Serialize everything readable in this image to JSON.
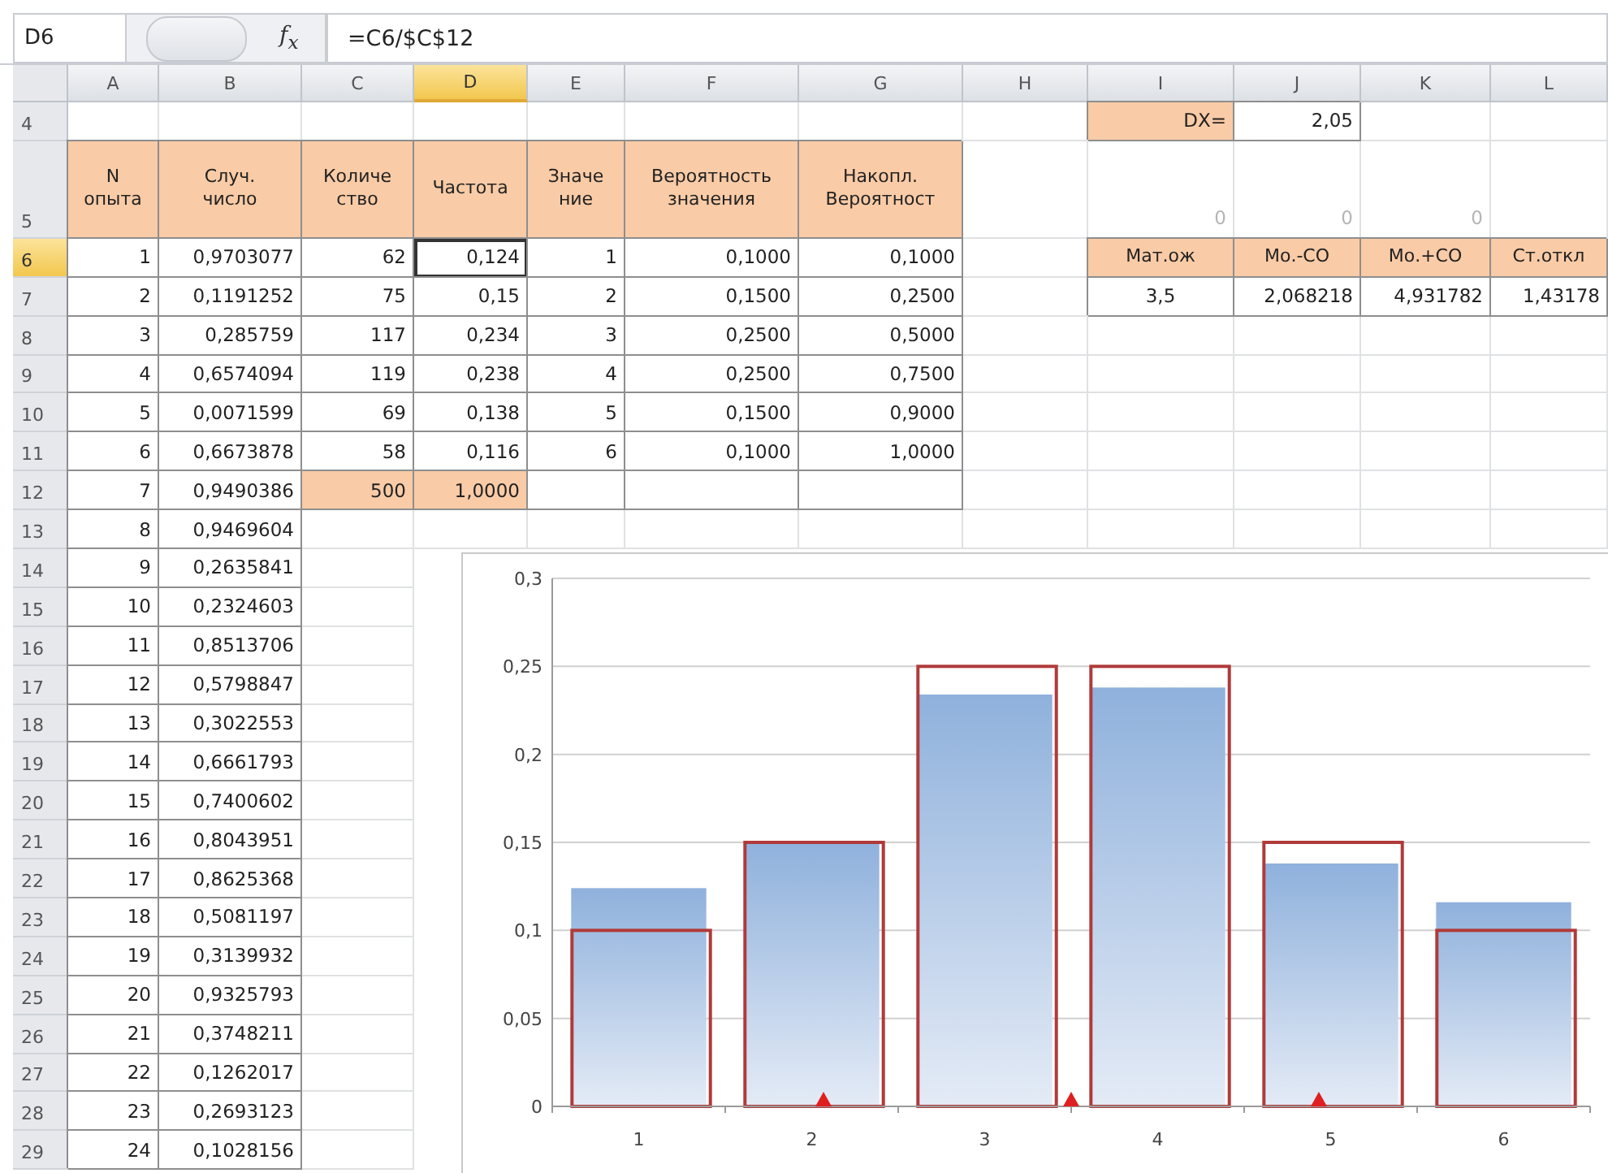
{
  "formula_bar": {
    "name_box": "D6",
    "function_button": "f$_{x}$",
    "formula": "=C6/$C$12"
  },
  "columns": [
    {
      "label": "A",
      "selected": false
    },
    {
      "label": "B",
      "selected": false
    },
    {
      "label": "C",
      "selected": false
    },
    {
      "label": "D",
      "selected": true
    },
    {
      "label": "E",
      "selected": false
    },
    {
      "label": "F",
      "selected": false
    },
    {
      "label": "G",
      "selected": false
    },
    {
      "label": "H",
      "selected": false
    },
    {
      "label": "I",
      "selected": false
    },
    {
      "label": "J",
      "selected": false
    },
    {
      "label": "K",
      "selected": false
    },
    {
      "label": "L",
      "selected": false
    }
  ],
  "rows": [
    {
      "number": "4",
      "selected": false,
      "cells": [
        {
          "kind": "empty"
        },
        {
          "kind": "empty"
        },
        {
          "kind": "empty"
        },
        {
          "kind": "empty"
        },
        {
          "kind": "empty"
        },
        {
          "kind": "empty"
        },
        {
          "kind": "empty"
        },
        {
          "kind": "empty"
        },
        {
          "kind": "total",
          "text": "DX=",
          "selected": false
        },
        {
          "kind": "value",
          "text": "2,05",
          "selected": false
        }
      ]
    },
    {
      "number": "5",
      "selected": false,
      "kind": "header",
      "cells": [
        {
          "kind": "heading",
          "text": "N\nопыта",
          "selected": false
        },
        {
          "kind": "heading",
          "text": "Случ.\nчисло",
          "selected": false
        },
        {
          "kind": "heading",
          "text": "Количе\nство",
          "selected": false
        },
        {
          "kind": "heading",
          "text": "Частота",
          "selected": false
        },
        {
          "kind": "heading",
          "text": "Значе\nние",
          "selected": false
        },
        {
          "kind": "heading",
          "text": "Вероятность\nзначения",
          "selected": false
        },
        {
          "kind": "heading",
          "text": "Накопл.\nВероятност",
          "selected": false
        },
        {
          "kind": "empty"
        },
        {
          "kind": "muted",
          "text": "0",
          "selected": false
        },
        {
          "kind": "muted",
          "text": "0",
          "selected": false
        },
        {
          "kind": "muted",
          "text": "0",
          "selected": false
        }
      ]
    },
    {
      "number": "6",
      "selected": true,
      "cells": [
        {
          "kind": "value",
          "text": "1",
          "selected": false
        },
        {
          "kind": "value",
          "text": "0,9703077",
          "selected": false
        },
        {
          "kind": "value",
          "text": "62",
          "selected": false
        },
        {
          "kind": "value",
          "text": "0,124",
          "selected": true
        },
        {
          "kind": "value",
          "text": "1",
          "selected": false
        },
        {
          "kind": "value",
          "text": "0,1000",
          "selected": false
        },
        {
          "kind": "value",
          "text": "0,1000",
          "selected": false
        },
        {
          "kind": "empty"
        },
        {
          "kind": "heading",
          "text": "Мат.ож",
          "selected": false
        },
        {
          "kind": "heading",
          "text": "Мо.-СО",
          "selected": false
        },
        {
          "kind": "heading",
          "text": "Мо.+СО",
          "selected": false
        },
        {
          "kind": "heading",
          "text": "Ст.откл",
          "selected": false
        }
      ]
    },
    {
      "number": "7",
      "selected": false,
      "cells": [
        {
          "kind": "value",
          "text": "2",
          "selected": false
        },
        {
          "kind": "value",
          "text": "0,1191252",
          "selected": false
        },
        {
          "kind": "value",
          "text": "75",
          "selected": false
        },
        {
          "kind": "value",
          "text": "0,15",
          "selected": false
        },
        {
          "kind": "value",
          "text": "2",
          "selected": false
        },
        {
          "kind": "value",
          "text": "0,1500",
          "selected": false
        },
        {
          "kind": "value",
          "text": "0,2500",
          "selected": false
        },
        {
          "kind": "empty"
        },
        {
          "kind": "centered",
          "text": "3,5",
          "selected": false
        },
        {
          "kind": "value",
          "text": "2,068218",
          "selected": false
        },
        {
          "kind": "value",
          "text": "4,931782",
          "selected": false
        },
        {
          "kind": "value",
          "text": "1,43178",
          "selected": false
        }
      ]
    },
    {
      "number": "8",
      "selected": false,
      "cells": [
        {
          "kind": "value",
          "text": "3",
          "selected": false
        },
        {
          "kind": "value",
          "text": "0,285759",
          "selected": false
        },
        {
          "kind": "value",
          "text": "117",
          "selected": false
        },
        {
          "kind": "value",
          "text": "0,234",
          "selected": false
        },
        {
          "kind": "value",
          "text": "3",
          "selected": false
        },
        {
          "kind": "value",
          "text": "0,2500",
          "selected": false
        },
        {
          "kind": "value",
          "text": "0,5000",
          "selected": false
        }
      ]
    },
    {
      "number": "9",
      "selected": false,
      "cells": [
        {
          "kind": "value",
          "text": "4",
          "selected": false
        },
        {
          "kind": "value",
          "text": "0,6574094",
          "selected": false
        },
        {
          "kind": "value",
          "text": "119",
          "selected": false
        },
        {
          "kind": "value",
          "text": "0,238",
          "selected": false
        },
        {
          "kind": "value",
          "text": "4",
          "selected": false
        },
        {
          "kind": "value",
          "text": "0,2500",
          "selected": false
        },
        {
          "kind": "value",
          "text": "0,7500",
          "selected": false
        }
      ]
    },
    {
      "number": "10",
      "selected": false,
      "cells": [
        {
          "kind": "value",
          "text": "5",
          "selected": false
        },
        {
          "kind": "value",
          "text": "0,0071599",
          "selected": false
        },
        {
          "kind": "value",
          "text": "69",
          "selected": false
        },
        {
          "kind": "value",
          "text": "0,138",
          "selected": false
        },
        {
          "kind": "value",
          "text": "5",
          "selected": false
        },
        {
          "kind": "value",
          "text": "0,1500",
          "selected": false
        },
        {
          "kind": "value",
          "text": "0,9000",
          "selected": false
        }
      ]
    },
    {
      "number": "11",
      "selected": false,
      "cells": [
        {
          "kind": "value",
          "text": "6",
          "selected": false
        },
        {
          "kind": "value",
          "text": "0,6673878",
          "selected": false
        },
        {
          "kind": "value",
          "text": "58",
          "selected": false
        },
        {
          "kind": "value",
          "text": "0,116",
          "selected": false
        },
        {
          "kind": "value",
          "text": "6",
          "selected": false
        },
        {
          "kind": "value",
          "text": "0,1000",
          "selected": false
        },
        {
          "kind": "value",
          "text": "1,0000",
          "selected": false
        }
      ]
    },
    {
      "number": "12",
      "selected": false,
      "cells": [
        {
          "kind": "value",
          "text": "7",
          "selected": false
        },
        {
          "kind": "value",
          "text": "0,9490386",
          "selected": false
        },
        {
          "kind": "total",
          "text": "500",
          "selected": false
        },
        {
          "kind": "total",
          "text": "1,0000",
          "selected": false
        },
        {
          "kind": "blank"
        },
        {
          "kind": "blank"
        },
        {
          "kind": "blank"
        }
      ]
    },
    {
      "number": "13",
      "selected": false,
      "cells": [
        {
          "kind": "value",
          "text": "8",
          "selected": false
        },
        {
          "kind": "value",
          "text": "0,9469604",
          "selected": false
        }
      ]
    },
    {
      "number": "14",
      "selected": false,
      "cells": [
        {
          "kind": "value",
          "text": "9",
          "selected": false
        },
        {
          "kind": "value",
          "text": "0,2635841",
          "selected": false
        }
      ]
    },
    {
      "number": "15",
      "selected": false,
      "cells": [
        {
          "kind": "value",
          "text": "10",
          "selected": false
        },
        {
          "kind": "value",
          "text": "0,2324603",
          "selected": false
        }
      ]
    },
    {
      "number": "16",
      "selected": false,
      "cells": [
        {
          "kind": "value",
          "text": "11",
          "selected": false
        },
        {
          "kind": "value",
          "text": "0,8513706",
          "selected": false
        }
      ]
    },
    {
      "number": "17",
      "selected": false,
      "cells": [
        {
          "kind": "value",
          "text": "12",
          "selected": false
        },
        {
          "kind": "value",
          "text": "0,5798847",
          "selected": false
        }
      ]
    },
    {
      "number": "18",
      "selected": false,
      "cells": [
        {
          "kind": "value",
          "text": "13",
          "selected": false
        },
        {
          "kind": "value",
          "text": "0,3022553",
          "selected": false
        }
      ]
    },
    {
      "number": "19",
      "selected": false,
      "cells": [
        {
          "kind": "value",
          "text": "14",
          "selected": false
        },
        {
          "kind": "value",
          "text": "0,6661793",
          "selected": false
        }
      ]
    },
    {
      "number": "20",
      "selected": false,
      "cells": [
        {
          "kind": "value",
          "text": "15",
          "selected": false
        },
        {
          "kind": "value",
          "text": "0,7400602",
          "selected": false
        }
      ]
    },
    {
      "number": "21",
      "selected": false,
      "cells": [
        {
          "kind": "value",
          "text": "16",
          "selected": false
        },
        {
          "kind": "value",
          "text": "0,8043951",
          "selected": false
        }
      ]
    },
    {
      "number": "22",
      "selected": false,
      "cells": [
        {
          "kind": "value",
          "text": "17",
          "selected": false
        },
        {
          "kind": "value",
          "text": "0,8625368",
          "selected": false
        }
      ]
    },
    {
      "number": "23",
      "selected": false,
      "cells": [
        {
          "kind": "value",
          "text": "18",
          "selected": false
        },
        {
          "kind": "value",
          "text": "0,5081197",
          "selected": false
        }
      ]
    },
    {
      "number": "24",
      "selected": false,
      "cells": [
        {
          "kind": "value",
          "text": "19",
          "selected": false
        },
        {
          "kind": "value",
          "text": "0,3139932",
          "selected": false
        }
      ]
    },
    {
      "number": "25",
      "selected": false,
      "cells": [
        {
          "kind": "value",
          "text": "20",
          "selected": false
        },
        {
          "kind": "value",
          "text": "0,9325793",
          "selected": false
        }
      ]
    },
    {
      "number": "26",
      "selected": false,
      "cells": [
        {
          "kind": "value",
          "text": "21",
          "selected": false
        },
        {
          "kind": "value",
          "text": "0,3748211",
          "selected": false
        }
      ]
    },
    {
      "number": "27",
      "selected": false,
      "cells": [
        {
          "kind": "value",
          "text": "22",
          "selected": false
        },
        {
          "kind": "value",
          "text": "0,1262017",
          "selected": false
        }
      ]
    },
    {
      "number": "28",
      "selected": false,
      "cells": [
        {
          "kind": "value",
          "text": "23",
          "selected": false
        },
        {
          "kind": "value",
          "text": "0,2693123",
          "selected": false
        }
      ]
    },
    {
      "number": "29",
      "selected": false,
      "cells": [
        {
          "kind": "value",
          "text": "24",
          "selected": false
        },
        {
          "kind": "value",
          "text": "0,1028156",
          "selected": false
        }
      ]
    }
  ],
  "chart": {
    "chart_data": {
      "type": "bar",
      "categories": [
        "1",
        "2",
        "3",
        "4",
        "5",
        "6"
      ],
      "series": [
        {
          "color": "#8fb1dc",
          "values": [
            0.124,
            0.15,
            0.234,
            0.238,
            0.138,
            0.116
          ]
        },
        {
          "color": "#b03a3a",
          "values": [
            0.1,
            0.15,
            0.25,
            0.25,
            0.15,
            0.1
          ]
        }
      ],
      "grid": true,
      "ylim": [
        0,
        0.3
      ],
      "yticks": [
        {
          "value": 0,
          "label": "0"
        },
        {
          "value": 0.05,
          "label": "0,05"
        },
        {
          "value": 0.1,
          "label": "0,1"
        },
        {
          "value": 0.15,
          "label": "0,15"
        },
        {
          "value": 0.2,
          "label": "0,2"
        },
        {
          "value": 0.25,
          "label": "0,25"
        },
        {
          "value": 0.3,
          "label": "0,3"
        }
      ]
    }
  }
}
